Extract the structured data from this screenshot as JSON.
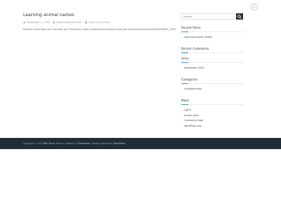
{
  "header": {
    "icon": "search-icon"
  },
  "post": {
    "title": "Learning animal names",
    "date": "September 4, 2020",
    "author": "wfasg.ad@gmail.com",
    "comments": "Leave a Comment",
    "excerpt": "Pexsoe med Djur på Svenska och Persiska. https://www.alsanaabsp.com/wp-content/uploads/2020/09/IMG_1038-1.mov"
  },
  "sidebar": {
    "search_placeholder": "Search ...",
    "recent_posts": {
      "title": "Recent Posts",
      "items": [
        "Learning animal names"
      ]
    },
    "recent_comments": {
      "title": "Recent Comments"
    },
    "archives": {
      "title": "Arkiv",
      "items": [
        "September 2020"
      ]
    },
    "categories": {
      "title": "Categories",
      "items": [
        "Uncategorized"
      ]
    },
    "meta": {
      "title": "Meta",
      "items": [
        "Log in",
        "Entries feed",
        "Comments feed",
        "WordPress.org"
      ]
    }
  },
  "footer": {
    "copyright": "Copyright © 2022 ",
    "site": "Nöh Skans",
    "theme_prefix": " Theme: Fooders by ",
    "theme_author": "ThemeInwp",
    "powered_prefix": ". Proudly powered by ",
    "powered_by": "WordPress",
    "suffix": "."
  },
  "colors": {
    "accent": "#3f8ec4",
    "footer_bg": "#222c37",
    "search_button": "#2d2d2d"
  }
}
